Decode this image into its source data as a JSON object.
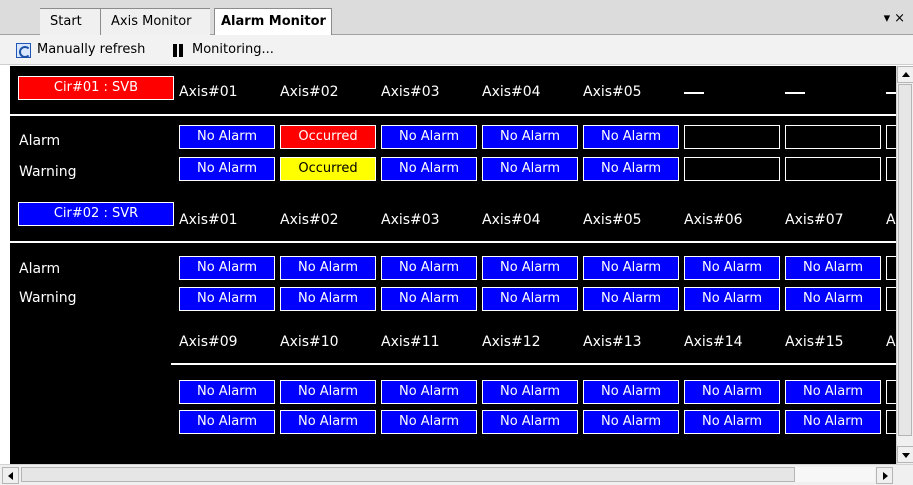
{
  "tabs": {
    "items": [
      {
        "label": "Start"
      },
      {
        "label": "Axis Monitor"
      },
      {
        "label": "Alarm Monitor"
      }
    ],
    "active": "Alarm Monitor",
    "pin_glyph": "▾",
    "close_glyph": "×"
  },
  "toolbar": {
    "refresh_label": "Manually refresh",
    "monitoring_label": "Monitoring...",
    "refresh_icon": "refresh-icon",
    "pause_icon": "pause-icon"
  },
  "colors": {
    "background": "#000000",
    "no_alarm": "#0000ff",
    "occurred_alarm": "#ff0000",
    "occurred_warning": "#ffff00",
    "cir01": "#ff0000",
    "cir02": "#0000ff"
  },
  "circuits": [
    {
      "label": "Cir#01 : SVB",
      "axes": [
        "Axis#01",
        "Axis#02",
        "Axis#03",
        "Axis#04",
        "Axis#05",
        "—",
        "—",
        "—"
      ],
      "alarm": [
        "No Alarm",
        "Occurred",
        "No Alarm",
        "No Alarm",
        "No Alarm",
        "",
        "",
        ""
      ],
      "warning": [
        "No Alarm",
        "Occurred",
        "No Alarm",
        "No Alarm",
        "No Alarm",
        "",
        "",
        ""
      ]
    },
    {
      "label": "Cir#02 : SVR",
      "axes": [
        "Axis#01",
        "Axis#02",
        "Axis#03",
        "Axis#04",
        "Axis#05",
        "Axis#06",
        "Axis#07",
        "A"
      ],
      "alarm": [
        "No Alarm",
        "No Alarm",
        "No Alarm",
        "No Alarm",
        "No Alarm",
        "No Alarm",
        "No Alarm",
        ""
      ],
      "warning": [
        "No Alarm",
        "No Alarm",
        "No Alarm",
        "No Alarm",
        "No Alarm",
        "No Alarm",
        "No Alarm",
        ""
      ],
      "axes2": [
        "Axis#09",
        "Axis#10",
        "Axis#11",
        "Axis#12",
        "Axis#13",
        "Axis#14",
        "Axis#15",
        "A"
      ],
      "alarm2": [
        "No Alarm",
        "No Alarm",
        "No Alarm",
        "No Alarm",
        "No Alarm",
        "No Alarm",
        "No Alarm",
        ""
      ],
      "warning2": [
        "No Alarm",
        "No Alarm",
        "No Alarm",
        "No Alarm",
        "No Alarm",
        "No Alarm",
        "No Alarm",
        ""
      ]
    }
  ],
  "row_labels": {
    "alarm": "Alarm",
    "warning": "Warning"
  }
}
